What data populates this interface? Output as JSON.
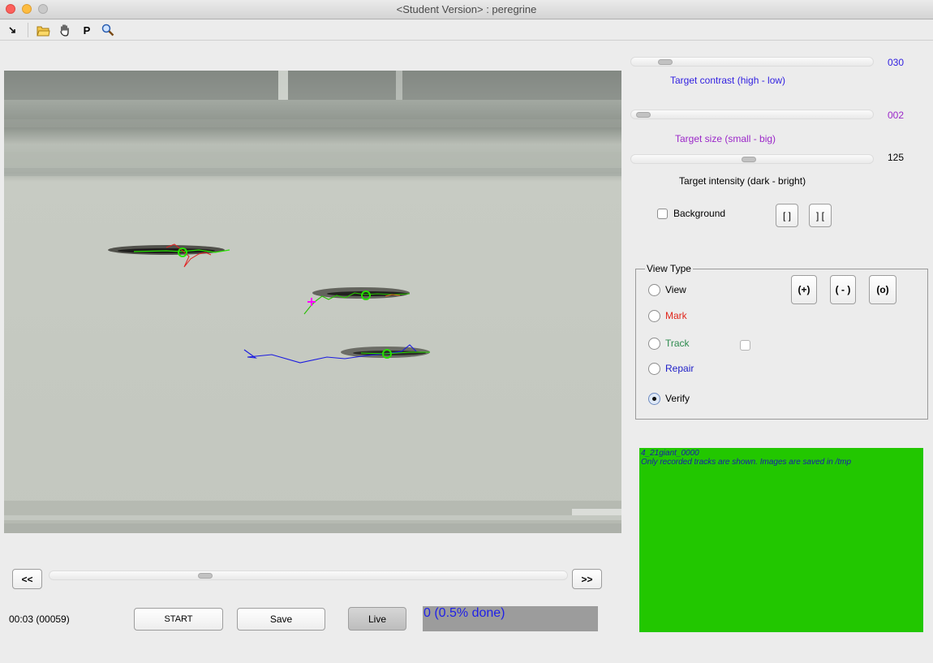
{
  "window": {
    "title": "<Student Version> : peregrine"
  },
  "toolbar": {
    "icons": [
      "arrow-icon",
      "open-folder-icon",
      "hand-pan-icon",
      "p-icon",
      "zoom-icon"
    ],
    "p_label": "P"
  },
  "controls": {
    "contrast": {
      "value": "030",
      "label": "Target contrast (high - low)",
      "level": 0.05,
      "color": "#2f1ee0"
    },
    "size": {
      "value": "002",
      "label": "Target size (small - big)",
      "level": 0.01,
      "color": "#9b27c9"
    },
    "intensity": {
      "value": "125",
      "label": "Target intensity (dark - bright)",
      "level": 0.49,
      "color": "#000000"
    },
    "background_label": "Background",
    "btn_bracket_open": "[ ]",
    "btn_bracket_close": "] ["
  },
  "view_type": {
    "title": "View Type",
    "options": [
      {
        "label": "View",
        "color": "#000000",
        "selected": false
      },
      {
        "label": "Mark",
        "color": "#e0261c",
        "selected": false
      },
      {
        "label": "Track",
        "color": "#2e8b4e",
        "selected": false
      },
      {
        "label": "Repair",
        "color": "#2020c8",
        "selected": false
      },
      {
        "label": "Verify",
        "color": "#000000",
        "selected": true
      }
    ],
    "btn_plus": "(+)",
    "btn_minus": "( - )",
    "btn_o": "(o)"
  },
  "message": {
    "line1": "4_21giant_0000",
    "line2": "Only recorded tracks are shown. Images are saved in /tmp"
  },
  "timeline": {
    "prev_label": "<<",
    "next_label": ">>",
    "position": 0.3
  },
  "bottom": {
    "time": "00:03 (00059)",
    "start": "START",
    "save": "Save",
    "live": "Live",
    "progress": "0 (0.5% done)"
  }
}
